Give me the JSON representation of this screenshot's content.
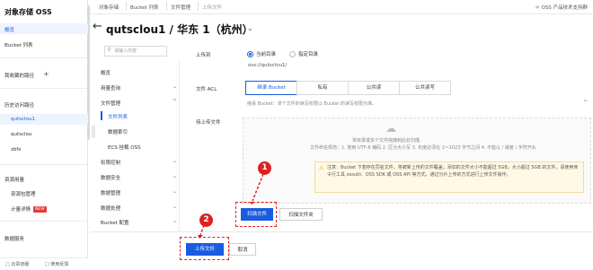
{
  "sidebar": {
    "title": "对象存储 OSS",
    "overview": "概览",
    "bucket_list": "Bucket 列表",
    "favorites": "我收藏的路径",
    "favorites_add": "+",
    "history_section": "历史访问路径",
    "history_items": [
      "qutsclou1",
      "qutsclou",
      "zbfs"
    ],
    "resource_section": "资源用量",
    "resource_items": [
      "资源包管理",
      "计量详情"
    ],
    "new_badge": "NEW",
    "data_service": "数据服务",
    "footer_links": [
      "云贵旧版",
      "使用反馈"
    ]
  },
  "topbar": {
    "crumbs": [
      "对象存储",
      "Bucket 列表",
      "文件管理",
      "上传文件"
    ],
    "right_text": "OSS 产品技术支持群"
  },
  "header": {
    "title": "qutsclou1 / 华东 1（杭州）",
    "dropdown_icon": "chevron-down-icon"
  },
  "subnav": {
    "search_placeholder": "请输入内容",
    "overview": "概览",
    "usage": "用量查询",
    "file_mgmt": "文件管理",
    "file_list": "文件列表",
    "data_index": "数据索引",
    "ecs": "ECS 挂载 OSS",
    "permission": "权限控制",
    "data_security": "数据安全",
    "data_mgmt": "数据管理",
    "data_process": "数据处理",
    "bucket_config": "Bucket 配置",
    "collapse_icon": "chevron-icon"
  },
  "form": {
    "upload_to_label": "上传到",
    "current_dir": "当前目录",
    "specified_dir": "指定目录",
    "path": "oss://qutsclou1/",
    "acl_label": "文件 ACL",
    "acl_options": [
      "继承 Bucket",
      "私有",
      "公共读",
      "公共读写"
    ],
    "acl_hint": "继承 Bucket：单个文件的读写权限以 Bucket 的读写权限为准。",
    "pending_label": "待上传文件",
    "drop_hint": "将目录或多个文件拖拽到此处扫描",
    "naming_rule": "文件命名规范：1. 使用 UTF-8 编码 2. 区分大小写 3. 长度必须在 1～1023 字节之间 4. 不能以 / 或者 \\ 字符开头",
    "warning": "注意：Bucket 下若存在同名文件，将被新上传的文件覆盖；添加的文件大小不能超过 5GB，大小超过 5GB 的文件，请使用命令行工具 ossutil、OSS SDK 或 OSS API 等方式，通过分片上传的方式进行上传文件操作。",
    "scan_file": "扫描文件",
    "scan_folder": "扫描文件夹",
    "upload_btn": "上传文件",
    "cancel_btn": "取消"
  },
  "annotations": [
    "1",
    "2"
  ],
  "colors": {
    "primary": "#1a5ce0",
    "annotation": "#e02020",
    "warning_bg": "#fff8e5"
  }
}
